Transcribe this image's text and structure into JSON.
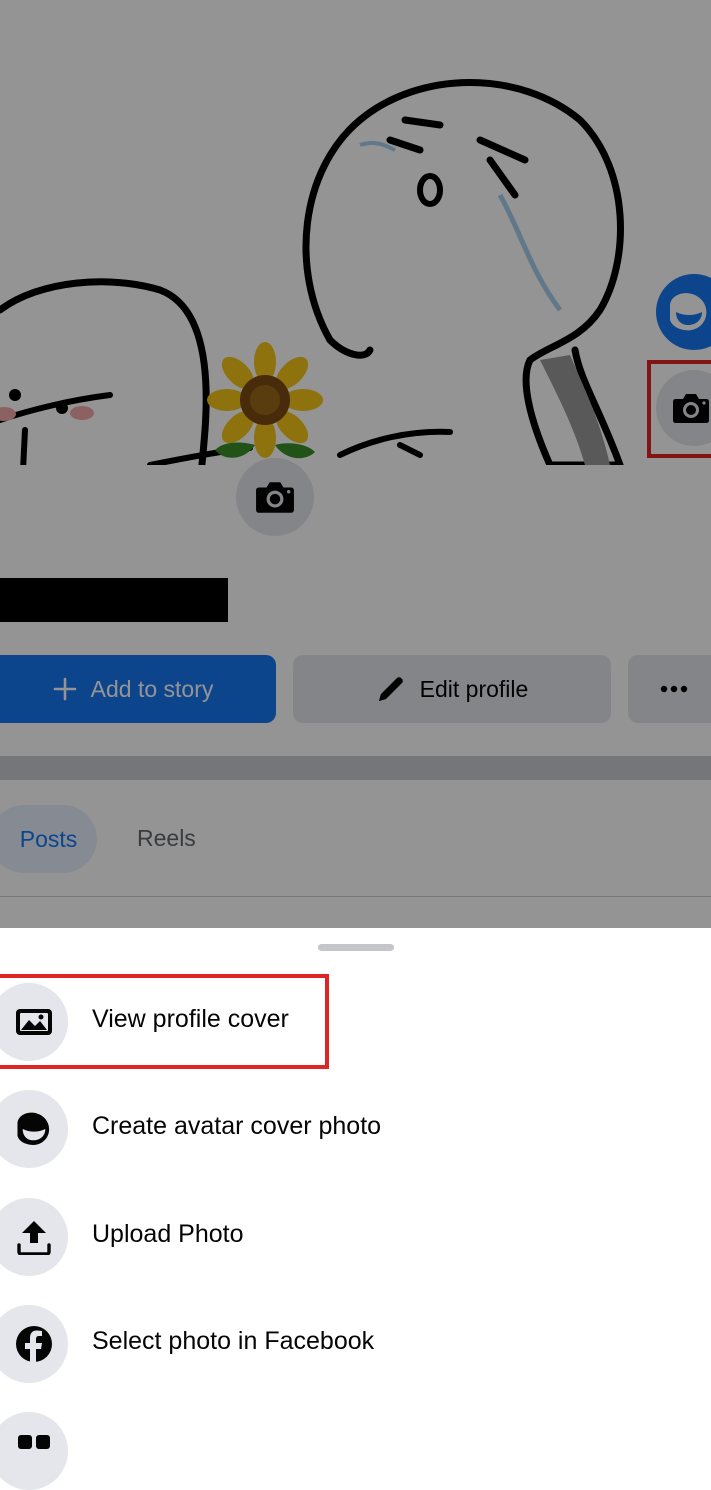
{
  "profile": {
    "add_story_label": "Add to story",
    "edit_profile_label": "Edit profile",
    "more_icon": "ellipsis-icon",
    "cover_camera_icon": "camera-icon",
    "profile_camera_icon": "camera-icon",
    "avatar_icon": "avatar-icon"
  },
  "tabs": [
    {
      "label": "Posts",
      "selected": true
    },
    {
      "label": "Reels",
      "selected": false
    }
  ],
  "sheet": {
    "items": [
      {
        "label": "View profile cover",
        "icon": "image-icon"
      },
      {
        "label": "Create avatar cover photo",
        "icon": "avatar-icon"
      },
      {
        "label": "Upload Photo",
        "icon": "upload-icon"
      },
      {
        "label": "Select photo in Facebook",
        "icon": "facebook-icon"
      }
    ]
  },
  "colors": {
    "brand_blue": "#1877f2",
    "highlight_red": "#e02424",
    "button_gray": "#e4e6eb"
  }
}
